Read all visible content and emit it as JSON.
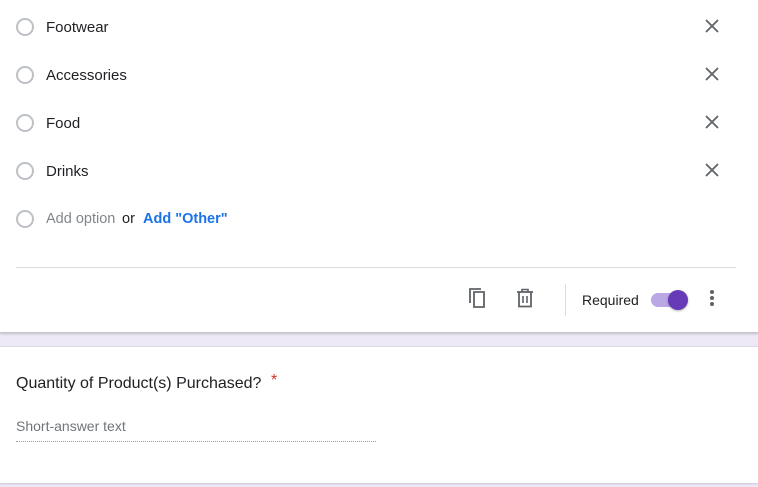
{
  "options": [
    {
      "label": "Footwear",
      "remove_icon": "close-icon"
    },
    {
      "label": "Accessories",
      "remove_icon": "close-icon"
    },
    {
      "label": "Food",
      "remove_icon": "close-icon"
    },
    {
      "label": "Drinks",
      "remove_icon": "close-icon"
    }
  ],
  "add_row": {
    "add_option": "Add option",
    "or": "or",
    "add_other": "Add \"Other\""
  },
  "toolbar": {
    "duplicate_icon": "copy-icon",
    "delete_icon": "trash-icon",
    "required_label": "Required",
    "required_on": true,
    "more_icon": "more-vert-icon"
  },
  "question": {
    "title": "Quantity of Product(s) Purchased?",
    "required_mark": "*",
    "answer_placeholder": "Short-answer text"
  },
  "colors": {
    "accent": "#673ab7",
    "link": "#1a73e8",
    "required": "#d93025",
    "background": "#ede9f6"
  }
}
